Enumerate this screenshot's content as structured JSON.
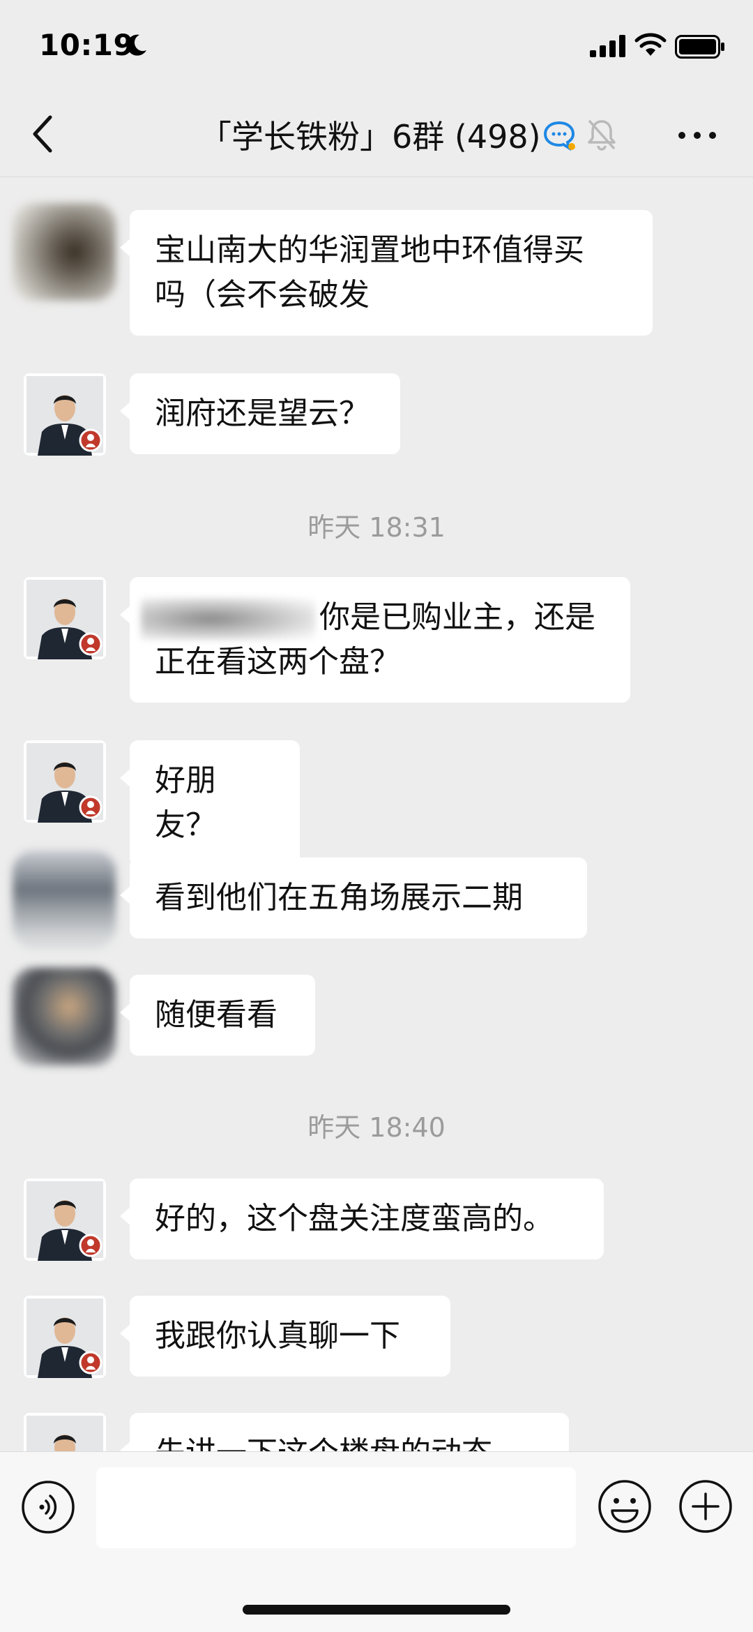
{
  "status_bar": {
    "time": "10:19"
  },
  "nav": {
    "back_label": "<",
    "title": "「学长铁粉」6群 (498)"
  },
  "messages": [
    {
      "type": "text",
      "avatar": "blurred",
      "text": "宝山南大的华润置地中环值得买吗（会不会破发",
      "lines": [
        "宝山南大的华润置地中环值得买",
        "吗（会不会破发"
      ]
    },
    {
      "type": "text",
      "avatar": "agent",
      "text": "润府还是望云？"
    },
    {
      "type": "time",
      "text": "昨天 18:31"
    },
    {
      "type": "text",
      "avatar": "agent",
      "line1_suffix": "你是已购业主，还是",
      "line2": "正在看这两个盘？"
    },
    {
      "type": "text",
      "avatar": "agent",
      "text": "好朋友？"
    },
    {
      "type": "text",
      "avatar": "blurred",
      "text": "看到他们在五角场展示二期"
    },
    {
      "type": "text",
      "avatar": "blurred",
      "text": "随便看看"
    },
    {
      "type": "time",
      "text": "昨天 18:40"
    },
    {
      "type": "text",
      "avatar": "agent",
      "text": "好的，这个盘关注度蛮高的。"
    },
    {
      "type": "text",
      "avatar": "agent",
      "text": "我跟你认真聊一下"
    },
    {
      "type": "text",
      "avatar": "agent",
      "text": "先讲一下这个楼盘的动态"
    }
  ],
  "composer": {
    "placeholder": ""
  },
  "colors": {
    "background": "#ededed",
    "bubble": "#ffffff",
    "timestamp": "#9b9b9b",
    "accent_blue": "#1e88e5"
  }
}
